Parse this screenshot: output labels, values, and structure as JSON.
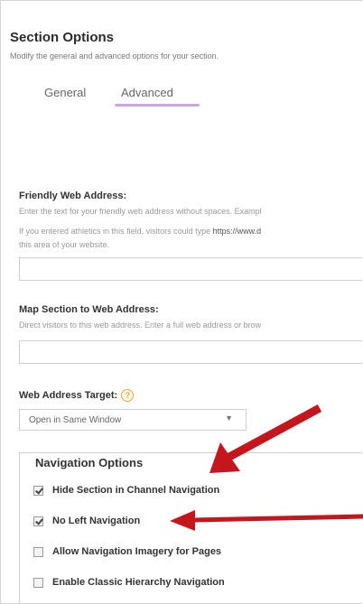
{
  "header": {
    "title": "Section Options",
    "subtitle": "Modify the general and advanced options for your section."
  },
  "tabs": [
    {
      "label": "General",
      "active": false
    },
    {
      "label": "Advanced",
      "active": true
    }
  ],
  "friendly": {
    "label": "Friendly Web Address:",
    "help1": "Enter the text for your friendly web address without spaces. Exampl",
    "help2_pre": "If you entered athletics in this field, visitors could type ",
    "help2_url": "https://www.d",
    "help3": "this area of your website.",
    "value": ""
  },
  "map": {
    "label": "Map Section to Web Address:",
    "help": "Direct visitors to this web address. Enter a full web address or brow",
    "value": ""
  },
  "target": {
    "label": "Web Address Target:",
    "help_icon": "?",
    "selected": "Open in Same Window",
    "caret": "▼"
  },
  "nav": {
    "legend": "Navigation Options",
    "options": [
      {
        "label": "Hide Section in Channel Navigation",
        "checked": true
      },
      {
        "label": "No Left Navigation",
        "checked": true
      },
      {
        "label": "Allow Navigation Imagery for Pages",
        "checked": false
      },
      {
        "label": "Enable Classic Hierarchy Navigation",
        "checked": false
      }
    ]
  },
  "colors": {
    "tab_underline": "#c9a6dd",
    "arrow": "#c4161c",
    "help_icon": "#e0a94a"
  }
}
